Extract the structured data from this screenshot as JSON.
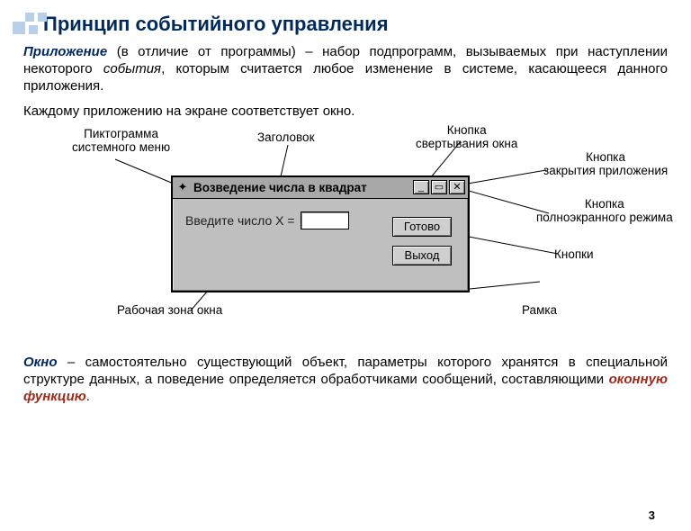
{
  "page": {
    "title": "Принцип событийного управления",
    "para1_term": "Приложение",
    "para1_a": " (в отличие от программы) – набор подпрограмм, вызываемых при наступлении некоторого ",
    "para1_ev": "события",
    "para1_b": ", которым считается любое изменение в системе, касающееся данного приложения.",
    "para2": "Каждому приложению на экране соответствует окно.",
    "para3_term": "Окно",
    "para3_a": " –  самостоятельно существующий объект, параметры которого хранятся в специальной структуре данных, а поведение определяется обработчиками сообщений, составляющими ",
    "para3_key": "оконную функцию",
    "para3_b": ".",
    "number": "3"
  },
  "callouts": {
    "sysmenu_icon": "Пиктограмма системного меню",
    "title": "Заголовок",
    "minimize": "Кнопка свертывания окна",
    "close": "Кнопка закрытия приложения",
    "maximize": "Кнопка полноэкранного режима",
    "buttons": "Кнопки",
    "frame": "Рамка",
    "workarea": "Рабочая зона окна"
  },
  "mockwin": {
    "title": "Возведение  числа в квадрат",
    "prompt": "Введите число X =",
    "btn_ready": "Готово",
    "btn_exit": "Выход",
    "icon_min": "_",
    "icon_max": "▭",
    "icon_close": "✕",
    "icon_sys": "✦"
  }
}
